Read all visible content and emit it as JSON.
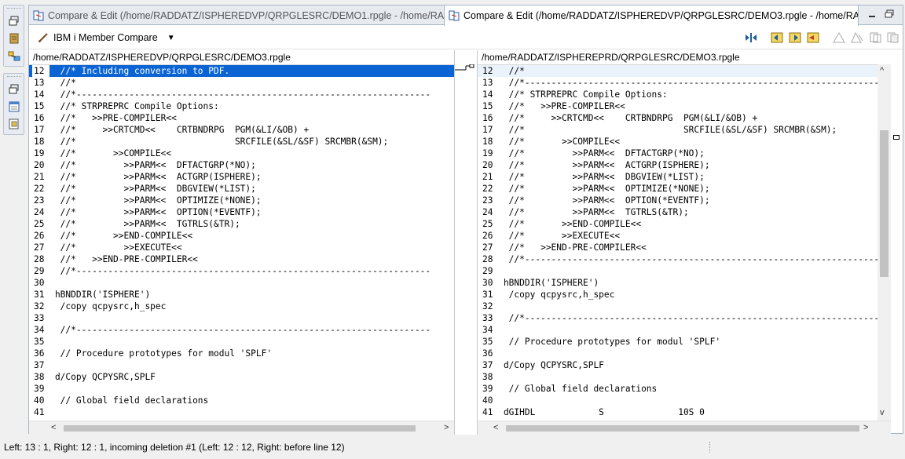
{
  "tabs": [
    {
      "title": "Compare & Edit (/home/RADDATZ/ISPHEREDVP/QRPGLESRC/DEMO1.rpgle - /home/RA...",
      "active": false
    },
    {
      "title": "Compare & Edit (/home/RADDATZ/ISPHEREDVP/QRPGLESRC/DEMO3.rpgle - /home/RA...",
      "active": true,
      "close": "✕"
    }
  ],
  "toolbar": {
    "title": "IBM i Member Compare",
    "icons": [
      "pencil-icon",
      "chevron-down-icon",
      "copy-all-left-to-right-icon",
      "next-change-icon",
      "previous-change-icon",
      "copy-current-change-icon",
      "show-ancestor-icon",
      "ignore-whitespace-icon",
      "merge-icon"
    ]
  },
  "left": {
    "path": "/home/RADDATZ/ISPHEREDVP/QRPGLESRC/DEMO3.rpgle",
    "lines": [
      {
        "n": "12",
        "t": "     //* Including conversion to PDF."
      },
      {
        "n": "13",
        "t": "     //*"
      },
      {
        "n": "14",
        "t": "     //*-------------------------------------------------------------------"
      },
      {
        "n": "15",
        "t": "     //* STRPREPRC Compile Options:"
      },
      {
        "n": "16",
        "t": "     //*   >>PRE-COMPILER<<"
      },
      {
        "n": "17",
        "t": "     //*     >>CRTCMD<<    CRTBNDRPG  PGM(&LI/&OB) +"
      },
      {
        "n": "18",
        "t": "     //*                              SRCFILE(&SL/&SF) SRCMBR(&SM);"
      },
      {
        "n": "19",
        "t": "     //*       >>COMPILE<<"
      },
      {
        "n": "20",
        "t": "     //*         >>PARM<<  DFTACTGRP(*NO);"
      },
      {
        "n": "21",
        "t": "     //*         >>PARM<<  ACTGRP(ISPHERE);"
      },
      {
        "n": "22",
        "t": "     //*         >>PARM<<  DBGVIEW(*LIST);"
      },
      {
        "n": "23",
        "t": "     //*         >>PARM<<  OPTIMIZE(*NONE);"
      },
      {
        "n": "24",
        "t": "     //*         >>PARM<<  OPTION(*EVENTF);"
      },
      {
        "n": "25",
        "t": "     //*         >>PARM<<  TGTRLS(&TR);"
      },
      {
        "n": "26",
        "t": "     //*       >>END-COMPILE<<"
      },
      {
        "n": "27",
        "t": "     //*         >>EXECUTE<<"
      },
      {
        "n": "28",
        "t": "     //*   >>END-PRE-COMPILER<<"
      },
      {
        "n": "29",
        "t": "     //*-------------------------------------------------------------------"
      },
      {
        "n": "30",
        "t": ""
      },
      {
        "n": "31",
        "t": "    hBNDDIR('ISPHERE')"
      },
      {
        "n": "32",
        "t": "     /copy qcpysrc,h_spec"
      },
      {
        "n": "33",
        "t": ""
      },
      {
        "n": "34",
        "t": "     //*-------------------------------------------------------------------"
      },
      {
        "n": "35",
        "t": ""
      },
      {
        "n": "36",
        "t": "     // Procedure prototypes for modul 'SPLF'"
      },
      {
        "n": "37",
        "t": ""
      },
      {
        "n": "38",
        "t": "    d/Copy QCPYSRC,SPLF"
      },
      {
        "n": "39",
        "t": ""
      },
      {
        "n": "40",
        "t": "     // Global field declarations"
      },
      {
        "n": "41",
        "t": ""
      }
    ]
  },
  "right": {
    "path": "/home/RADDATZ/ISPHEREPRD/QRPGLESRC/DEMO3.rpgle",
    "lines": [
      {
        "n": "12",
        "t": "     //*"
      },
      {
        "n": "13",
        "t": "     //*-------------------------------------------------------------------"
      },
      {
        "n": "14",
        "t": "     //* STRPREPRC Compile Options:"
      },
      {
        "n": "15",
        "t": "     //*   >>PRE-COMPILER<<"
      },
      {
        "n": "16",
        "t": "     //*     >>CRTCMD<<    CRTBNDRPG  PGM(&LI/&OB) +"
      },
      {
        "n": "17",
        "t": "     //*                              SRCFILE(&SL/&SF) SRCMBR(&SM);"
      },
      {
        "n": "18",
        "t": "     //*       >>COMPILE<<"
      },
      {
        "n": "19",
        "t": "     //*         >>PARM<<  DFTACTGRP(*NO);"
      },
      {
        "n": "20",
        "t": "     //*         >>PARM<<  ACTGRP(ISPHERE);"
      },
      {
        "n": "21",
        "t": "     //*         >>PARM<<  DBGVIEW(*LIST);"
      },
      {
        "n": "22",
        "t": "     //*         >>PARM<<  OPTIMIZE(*NONE);"
      },
      {
        "n": "23",
        "t": "     //*         >>PARM<<  OPTION(*EVENTF);"
      },
      {
        "n": "24",
        "t": "     //*         >>PARM<<  TGTRLS(&TR);"
      },
      {
        "n": "25",
        "t": "     //*       >>END-COMPILE<<"
      },
      {
        "n": "26",
        "t": "     //*       >>EXECUTE<<"
      },
      {
        "n": "27",
        "t": "     //*   >>END-PRE-COMPILER<<"
      },
      {
        "n": "28",
        "t": "     //*-------------------------------------------------------------------"
      },
      {
        "n": "29",
        "t": ""
      },
      {
        "n": "30",
        "t": "    hBNDDIR('ISPHERE')"
      },
      {
        "n": "31",
        "t": "     /copy qcpysrc,h_spec"
      },
      {
        "n": "32",
        "t": ""
      },
      {
        "n": "33",
        "t": "     //*-------------------------------------------------------------------"
      },
      {
        "n": "34",
        "t": ""
      },
      {
        "n": "35",
        "t": "     // Procedure prototypes for modul 'SPLF'"
      },
      {
        "n": "36",
        "t": ""
      },
      {
        "n": "37",
        "t": "    d/Copy QCPYSRC,SPLF"
      },
      {
        "n": "38",
        "t": ""
      },
      {
        "n": "39",
        "t": "     // Global field declarations"
      },
      {
        "n": "40",
        "t": ""
      },
      {
        "n": "41",
        "t": "    dGIHDL            S              10S 0"
      }
    ]
  },
  "scroll_arrows": {
    "left": "<",
    "right": ">",
    "up": "^",
    "down": "v"
  },
  "status": "Left: 13 : 1, Right: 12 : 1, incoming deletion #1 (Left: 12 : 12, Right: before line 12)",
  "colors": {
    "selection": "#0a64d4",
    "border": "#a9b6c8",
    "tabbar": "#e7ebf0"
  }
}
